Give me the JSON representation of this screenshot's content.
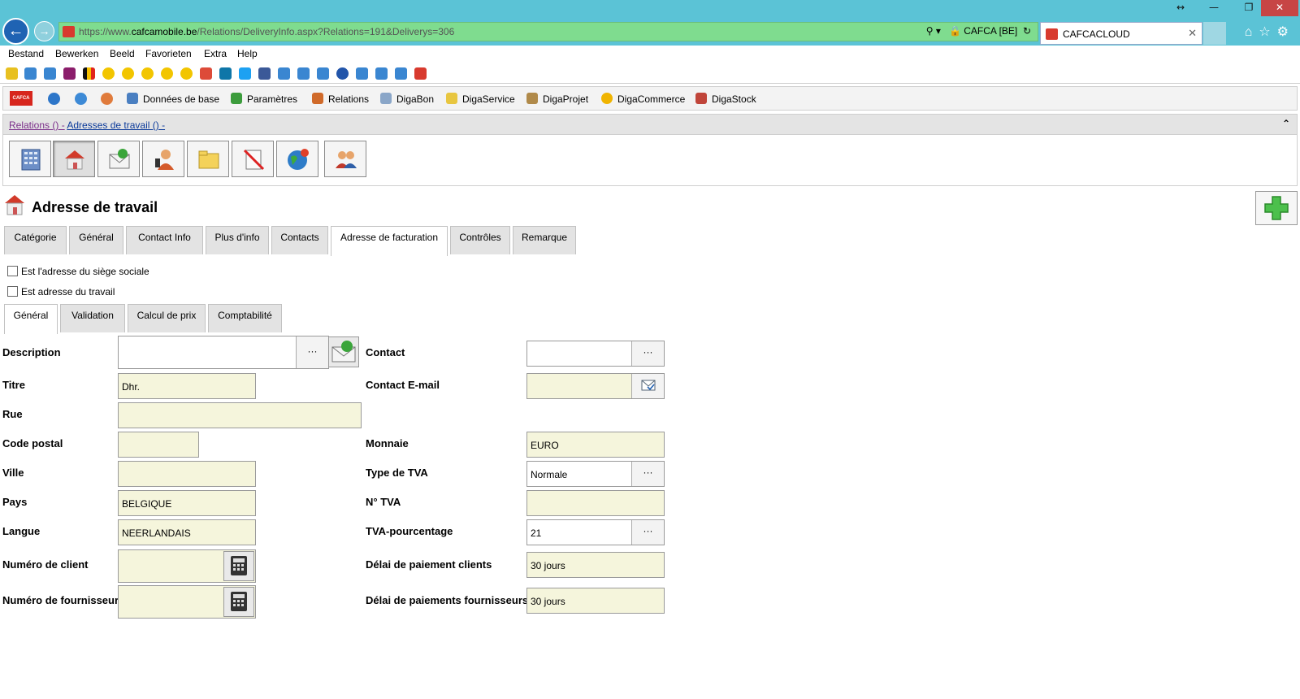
{
  "browser": {
    "window_controls": {
      "resize": "↔",
      "minimize": "—",
      "restore": "❐",
      "close": "✕"
    },
    "url_prefix": "https://www.",
    "url_domain": "cafcamobile.be",
    "url_path": "/Relations/DeliveryInfo.aspx?Relations=191&Deliverys=306",
    "site_identity": "CAFCA [BE]",
    "tab_title": "CAFCACLOUD",
    "menu": [
      "Bestand",
      "Bewerken",
      "Beeld",
      "Favorieten",
      "Extra",
      "Help"
    ]
  },
  "app_toolbar": {
    "items": [
      "Données de base",
      "Paramètres",
      "Relations",
      "DigaBon",
      "DigaService",
      "DigaProjet",
      "DigaCommerce",
      "DigaStock"
    ]
  },
  "breadcrumb": {
    "part1": "Relations () -",
    "part2": "Adresses de travail () -",
    "collapse": "⌃"
  },
  "page": {
    "title": "Adresse de travail"
  },
  "main_tabs": [
    "Catégorie",
    "Général",
    "Contact Info",
    "Plus d'info",
    "Contacts",
    "Adresse de facturation",
    "Contrôles",
    "Remarque"
  ],
  "main_tabs_active": "Adresse de facturation",
  "checkboxes": {
    "siege": "Est l'adresse du siège sociale",
    "travail": "Est adresse du travail"
  },
  "sub_tabs": [
    "Général",
    "Validation",
    "Calcul de prix",
    "Comptabilité"
  ],
  "sub_tabs_active": "Général",
  "form": {
    "description": {
      "label": "Description",
      "value": ""
    },
    "titre": {
      "label": "Titre",
      "value": "Dhr."
    },
    "rue": {
      "label": "Rue",
      "value": ""
    },
    "code_postal": {
      "label": "Code postal",
      "value": ""
    },
    "ville": {
      "label": "Ville",
      "value": ""
    },
    "pays": {
      "label": "Pays",
      "value": "BELGIQUE"
    },
    "langue": {
      "label": "Langue",
      "value": "NEERLANDAIS"
    },
    "numero_client": {
      "label": "Numéro de client",
      "value": ""
    },
    "numero_fournisseur": {
      "label": "Numéro de fournisseur",
      "value": ""
    },
    "contact": {
      "label": "Contact",
      "value": ""
    },
    "contact_email": {
      "label": "Contact E-mail",
      "value": ""
    },
    "monnaie": {
      "label": "Monnaie",
      "value": "EURO"
    },
    "type_tva": {
      "label": "Type de TVA",
      "value": "Normale"
    },
    "no_tva": {
      "label": "N° TVA",
      "value": ""
    },
    "tva_pourcentage": {
      "label": "TVA-pourcentage",
      "value": "21"
    },
    "delai_clients": {
      "label": "Délai de paiement clients",
      "value": "30 jours"
    },
    "delai_fournisseurs": {
      "label": "Délai de paiements fournisseurs",
      "value": "30 jours"
    },
    "dots": "···"
  },
  "colors": {
    "chrome": "#5bc3d6",
    "address_bar": "#7fdc8f",
    "field_bg": "#f5f5dc",
    "link": "#0b3a9a"
  }
}
